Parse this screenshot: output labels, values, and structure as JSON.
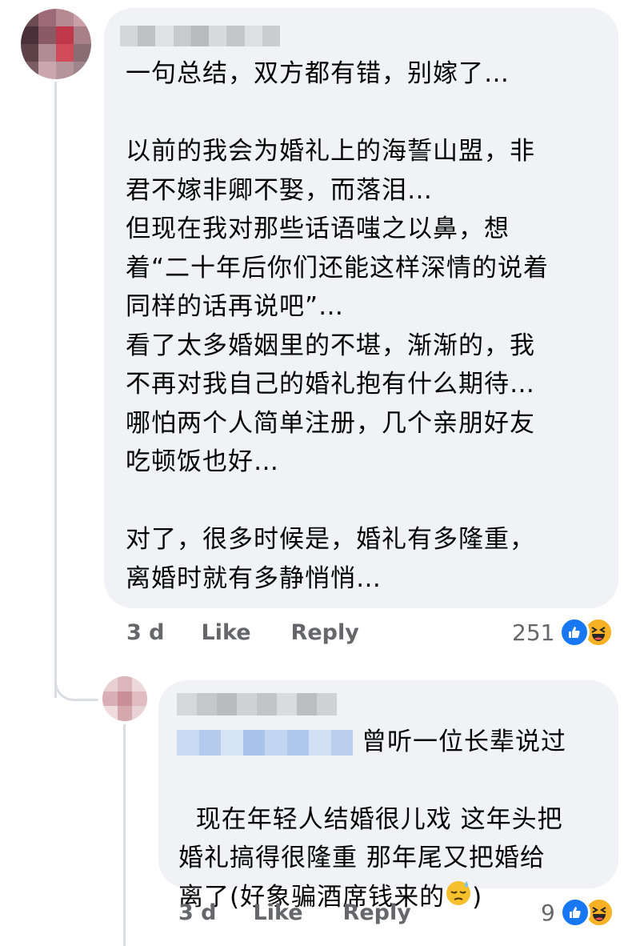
{
  "colors": {
    "bubble": "#f0f2f5",
    "text": "#050505",
    "meta": "#65676b",
    "like_blue": "#1877f2",
    "haha_yellow": "#f7b125",
    "thread_line": "#dadde1"
  },
  "comments": [
    {
      "author_name": "",
      "text": "一句总结，双方都有错，别嫁了…\n\n以前的我会为婚礼上的海誓山盟，非\n君不嫁非卿不娶，而落泪…\n但现在我对那些话语嗤之以鼻，想\n着“二十年后你们还能这样深情的说着\n同样的话再说吧”…\n看了太多婚姻里的不堪，渐渐的，我\n不再对我自己的婚礼抱有什么期待…\n哪怕两个人简单注册，几个亲朋好友\n吃顿饭也好…\n\n对了，很多时候是，婚礼有多隆重，\n离婚时就有多静悄悄…",
      "time": "3 d",
      "like_label": "Like",
      "reply_label": "Reply",
      "reaction_count": "251",
      "reaction_icons": [
        "like-icon",
        "haha-icon"
      ]
    },
    {
      "author_name": "",
      "mention": "",
      "text_line1": "曾听一位长辈说过",
      "text_rest": "现在年轻人结婚很儿戏 这年头把\n婚礼搞得很隆重 那年尾又把婚给\n离了(好象骗酒席钱来的",
      "text_end": ")",
      "emoji": "sweat-face-icon",
      "time": "3 d",
      "like_label": "Like",
      "reply_label": "Reply",
      "reaction_count": "9",
      "reaction_icons": [
        "like-icon",
        "haha-icon"
      ]
    }
  ]
}
